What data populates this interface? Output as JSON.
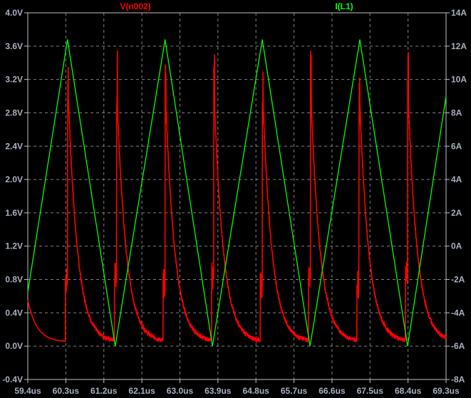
{
  "chart_data": {
    "type": "line",
    "title_left": "V(n002)",
    "title_right": "I(L1)",
    "xlabel": "",
    "x_unit": "us",
    "xlim": [
      59.4,
      69.3
    ],
    "x_ticks": [
      "59.4us",
      "60.3us",
      "61.2us",
      "62.1us",
      "63.0us",
      "63.9us",
      "64.8us",
      "65.7us",
      "66.6us",
      "67.5us",
      "68.4us",
      "69.3us"
    ],
    "y_left_lim": [
      -0.4,
      4.0
    ],
    "y_left_ticks": [
      "4.0V",
      "3.6V",
      "3.2V",
      "2.8V",
      "2.4V",
      "2.0V",
      "1.6V",
      "1.2V",
      "0.8V",
      "0.4V",
      "0.0V",
      "-0.4V"
    ],
    "y_right_lim": [
      -8,
      14
    ],
    "y_right_ticks": [
      "14A",
      "12A",
      "10A",
      "8A",
      "6A",
      "4A",
      "2A",
      "0A",
      "-2A",
      "-4A",
      "-6A",
      "-8A"
    ],
    "grid": true,
    "colors": {
      "background": "#000000",
      "grid": "#808080",
      "axis": "#c0c0c0",
      "v_series": "#ff0000",
      "i_series": "#00ff00",
      "tick_text": "#a8b0c0"
    },
    "series": [
      {
        "name": "V(n002)",
        "axis": "left",
        "unit": "V",
        "baseline": 0.05,
        "initial_value": 0.55,
        "decay_tau_us": 0.22,
        "events": [
          {
            "t": 60.29,
            "step": 0.8,
            "peak": 3.65,
            "decay_start": 3.0
          },
          {
            "t": 61.45,
            "step": 0.85,
            "peak": 3.57,
            "decay_start": 2.9
          },
          {
            "t": 62.6,
            "step": 0.75,
            "peak": 3.45,
            "decay_start": 2.9
          },
          {
            "t": 63.75,
            "step": 0.85,
            "peak": 3.57,
            "decay_start": 2.9
          },
          {
            "t": 64.9,
            "step": 0.75,
            "peak": 3.35,
            "decay_start": 2.9
          },
          {
            "t": 66.04,
            "step": 0.85,
            "peak": 3.57,
            "decay_start": 2.9
          },
          {
            "t": 67.19,
            "step": 0.75,
            "peak": 3.5,
            "decay_start": 2.9
          },
          {
            "t": 68.34,
            "step": 0.85,
            "peak": 3.57,
            "decay_start": 2.9
          }
        ]
      },
      {
        "name": "I(L1)",
        "axis": "right",
        "unit": "A",
        "points": [
          [
            59.4,
            -2.75
          ],
          [
            60.34,
            12.4
          ],
          [
            61.47,
            -6.0
          ],
          [
            62.65,
            12.4
          ],
          [
            63.77,
            -6.0
          ],
          [
            64.95,
            12.4
          ],
          [
            66.08,
            -6.0
          ],
          [
            67.26,
            12.4
          ],
          [
            68.39,
            -6.0
          ],
          [
            69.3,
            9.0
          ]
        ]
      }
    ]
  }
}
